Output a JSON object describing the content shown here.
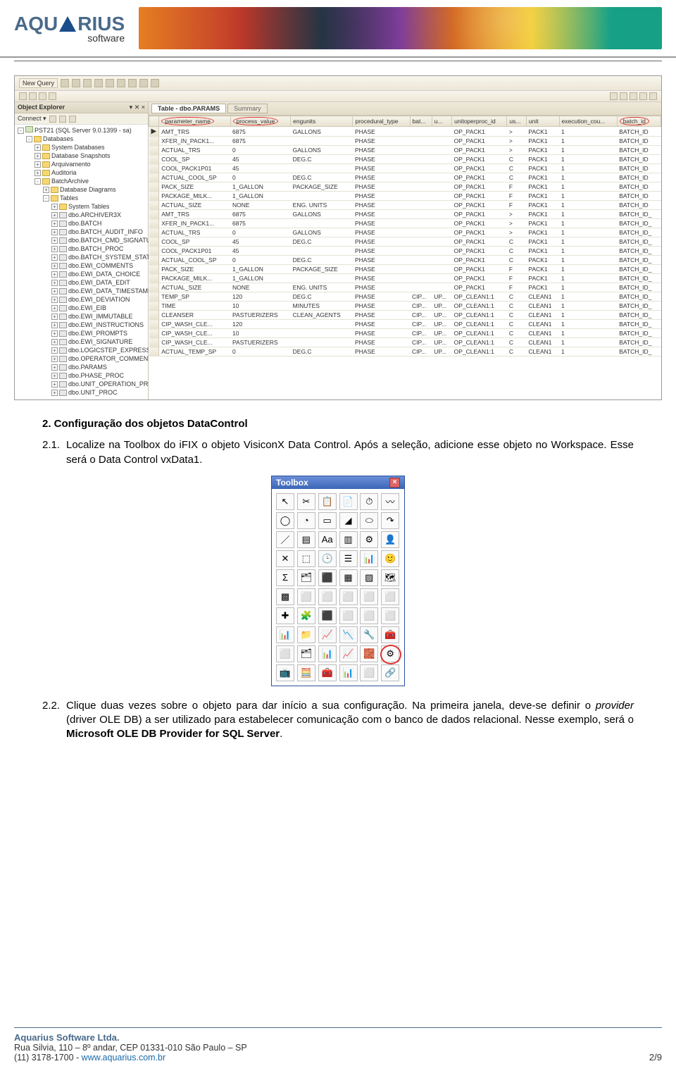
{
  "brand": {
    "name": "AQUARIUS",
    "sub": "software"
  },
  "ssms": {
    "toolbar": {
      "newquery": "New Query"
    },
    "explorer": {
      "title": "Object Explorer",
      "close": "▾ ✕ ×",
      "connect": "Connect ▾",
      "server": "PST21 (SQL Server 9.0.1399 - sa)",
      "root": "Databases",
      "nodes": [
        "System Databases",
        "Database Snapshots",
        "Arquivamento",
        "Auditoria",
        "BatchArchive"
      ],
      "open": [
        "Database Diagrams",
        "Tables"
      ],
      "tables": [
        "System Tables",
        "dbo.ARCHIVER3X",
        "dbo.BATCH",
        "dbo.BATCH_AUDIT_INFO",
        "dbo.BATCH_CMD_SIGNATURE",
        "dbo.BATCH_PROC",
        "dbo.BATCH_SYSTEM_STATUS",
        "dbo.EWI_COMMENTS",
        "dbo.EWI_DATA_CHOICE",
        "dbo.EWI_DATA_EDIT",
        "dbo.EWI_DATA_TIMESTAMP",
        "dbo.EWI_DEVIATION",
        "dbo.EWI_EIB",
        "dbo.EWI_IMMUTABLE",
        "dbo.EWI_INSTRUCTIONS",
        "dbo.EWI_PROMPTS",
        "dbo.EWI_SIGNATURE",
        "dbo.LOGICSTEP_EXPRESSION",
        "dbo.OPERATOR_COMMENTS",
        "dbo.PARAMS",
        "dbo.PHASE_PROC",
        "dbo.UNIT_OPERATION_PROC",
        "dbo.UNIT_PROC"
      ]
    },
    "tabs": {
      "active": "Table - dbo.PARAMS",
      "inactive": "Summary"
    },
    "columns": [
      "parameter_name",
      "process_value",
      "engunits",
      "procedural_type",
      "bat...",
      "u...",
      "unitoperproc_id",
      "us...",
      "unit",
      "execution_cou...",
      "batch_id"
    ],
    "circled_cols": [
      0,
      1,
      10
    ],
    "rows": [
      [
        "AMT_TRS",
        "6875",
        "GALLONS",
        "PHASE",
        "",
        "",
        "OP_PACK1",
        ">",
        "PACK1",
        "1",
        "BATCH_ID"
      ],
      [
        "XFER_IN_PACK1...",
        "6875",
        "",
        "PHASE",
        "",
        "",
        "OP_PACK1",
        ">",
        "PACK1",
        "1",
        "BATCH_ID"
      ],
      [
        "ACTUAL_TRS",
        "0",
        "GALLONS",
        "PHASE",
        "",
        "",
        "OP_PACK1",
        ">",
        "PACK1",
        "1",
        "BATCH_ID"
      ],
      [
        "COOL_SP",
        "45",
        "DEG.C",
        "PHASE",
        "",
        "",
        "OP_PACK1",
        "C",
        "PACK1",
        "1",
        "BATCH_ID"
      ],
      [
        "COOL_PACK1P01",
        "45",
        "",
        "PHASE",
        "",
        "",
        "OP_PACK1",
        "C",
        "PACK1",
        "1",
        "BATCH_ID"
      ],
      [
        "ACTUAL_COOL_SP",
        "0",
        "DEG.C",
        "PHASE",
        "",
        "",
        "OP_PACK1",
        "C",
        "PACK1",
        "1",
        "BATCH_ID"
      ],
      [
        "PACK_SIZE",
        "1_GALLON",
        "PACKAGE_SIZE",
        "PHASE",
        "",
        "",
        "OP_PACK1",
        "F",
        "PACK1",
        "1",
        "BATCH_ID"
      ],
      [
        "PACKAGE_MILK...",
        "1_GALLON",
        "",
        "PHASE",
        "",
        "",
        "OP_PACK1",
        "F",
        "PACK1",
        "1",
        "BATCH_ID"
      ],
      [
        "ACTUAL_SIZE",
        "NONE",
        "ENG. UNITS",
        "PHASE",
        "",
        "",
        "OP_PACK1",
        "F",
        "PACK1",
        "1",
        "BATCH_ID"
      ],
      [
        "AMT_TRS",
        "6875",
        "GALLONS",
        "PHASE",
        "",
        "",
        "OP_PACK1",
        ">",
        "PACK1",
        "1",
        "BATCH_ID_"
      ],
      [
        "XFER_IN_PACK1...",
        "6875",
        "",
        "PHASE",
        "",
        "",
        "OP_PACK1",
        ">",
        "PACK1",
        "1",
        "BATCH_ID_"
      ],
      [
        "ACTUAL_TRS",
        "0",
        "GALLONS",
        "PHASE",
        "",
        "",
        "OP_PACK1",
        ">",
        "PACK1",
        "1",
        "BATCH_ID_"
      ],
      [
        "COOL_SP",
        "45",
        "DEG.C",
        "PHASE",
        "",
        "",
        "OP_PACK1",
        "C",
        "PACK1",
        "1",
        "BATCH_ID_"
      ],
      [
        "COOL_PACK1P01",
        "45",
        "",
        "PHASE",
        "",
        "",
        "OP_PACK1",
        "C",
        "PACK1",
        "1",
        "BATCH_ID_"
      ],
      [
        "ACTUAL_COOL_SP",
        "0",
        "DEG.C",
        "PHASE",
        "",
        "",
        "OP_PACK1",
        "C",
        "PACK1",
        "1",
        "BATCH_ID_"
      ],
      [
        "PACK_SIZE",
        "1_GALLON",
        "PACKAGE_SIZE",
        "PHASE",
        "",
        "",
        "OP_PACK1",
        "F",
        "PACK1",
        "1",
        "BATCH_ID_"
      ],
      [
        "PACKAGE_MILK...",
        "1_GALLON",
        "",
        "PHASE",
        "",
        "",
        "OP_PACK1",
        "F",
        "PACK1",
        "1",
        "BATCH_ID_"
      ],
      [
        "ACTUAL_SIZE",
        "NONE",
        "ENG. UNITS",
        "PHASE",
        "",
        "",
        "OP_PACK1",
        "F",
        "PACK1",
        "1",
        "BATCH_ID_"
      ],
      [
        "TEMP_SP",
        "120",
        "DEG.C",
        "PHASE",
        "CIP...",
        "UP...",
        "OP_CLEAN1:1",
        "C",
        "CLEAN1",
        "1",
        "BATCH_ID_"
      ],
      [
        "TIME",
        "10",
        "MINUTES",
        "PHASE",
        "CIP...",
        "UP...",
        "OP_CLEAN1:1",
        "C",
        "CLEAN1",
        "1",
        "BATCH_ID_"
      ],
      [
        "CLEANSER",
        "PASTUERIZERS",
        "CLEAN_AGENTS",
        "PHASE",
        "CIP...",
        "UP...",
        "OP_CLEAN1:1",
        "C",
        "CLEAN1",
        "1",
        "BATCH_ID_"
      ],
      [
        "CIP_WASH_CLE...",
        "120",
        "",
        "PHASE",
        "CIP...",
        "UP...",
        "OP_CLEAN1:1",
        "C",
        "CLEAN1",
        "1",
        "BATCH_ID_"
      ],
      [
        "CIP_WASH_CLE...",
        "10",
        "",
        "PHASE",
        "CIP...",
        "UP...",
        "OP_CLEAN1:1",
        "C",
        "CLEAN1",
        "1",
        "BATCH_ID_"
      ],
      [
        "CIP_WASH_CLE...",
        "PASTUERIZERS",
        "",
        "PHASE",
        "CIP...",
        "UP...",
        "OP_CLEAN1:1",
        "C",
        "CLEAN1",
        "1",
        "BATCH_ID_"
      ],
      [
        "ACTUAL_TEMP_SP",
        "0",
        "DEG.C",
        "PHASE",
        "CIP...",
        "UP...",
        "OP_CLEAN1:1",
        "C",
        "CLEAN1",
        "1",
        "BATCH_ID_"
      ]
    ]
  },
  "section": {
    "title": "2.   Configuração dos objetos DataControl",
    "items": [
      {
        "num": "2.1.",
        "text": "Localize na Toolbox do iFIX o objeto VisiconX Data Control. Após a seleção, adicione esse objeto no Workspace. Esse será o Data Control vxData1."
      },
      {
        "num": "2.2.",
        "text_a": "Clique duas vezes sobre o objeto para dar início a sua configuração. Na primeira janela, deve-se definir o ",
        "em": "provider",
        "text_b": " (driver OLE DB) a ser utilizado para estabelecer comunicação com o banco de dados relacional. Nesse exemplo, será o ",
        "bold": "Microsoft OLE DB Provider for SQL Server",
        "text_c": "."
      }
    ]
  },
  "toolbox": {
    "title": "Toolbox",
    "icons": [
      "↖",
      "✂",
      "📋",
      "📄",
      "⏱",
      "〰",
      "◯",
      "◔",
      "▭",
      "◢",
      "⬭",
      "↷",
      "／",
      "▤",
      "Aa",
      "▥",
      "⚙",
      "👤",
      "✕",
      "⬚",
      "🕒",
      "☰",
      "📊",
      "🙂",
      "Σ",
      "🗂",
      "⬛",
      "▦",
      "▨",
      "🗺",
      "▩",
      "⬜",
      "⬜",
      "⬜",
      "⬜",
      "⬜",
      "✚",
      "🧩",
      "⬛",
      "⬜",
      "⬜",
      "⬜",
      "📊",
      "📁",
      "📈",
      "📉",
      "🔧",
      "🧰",
      "⬜",
      "🗂",
      "📊",
      "📈",
      "🧱",
      "⚙",
      "📺",
      "🧮",
      "🧰",
      "📊",
      "⬜",
      "🔗"
    ],
    "circled_index": 53
  },
  "footer": {
    "company": "Aquarius Software Ltda.",
    "address": "Rua Silvia, 110 – 8º andar, CEP 01331-010 São Paulo – SP",
    "phone": "(11) 3178-1700 - ",
    "link": "www.aquarius.com.br",
    "page": "2/9"
  }
}
